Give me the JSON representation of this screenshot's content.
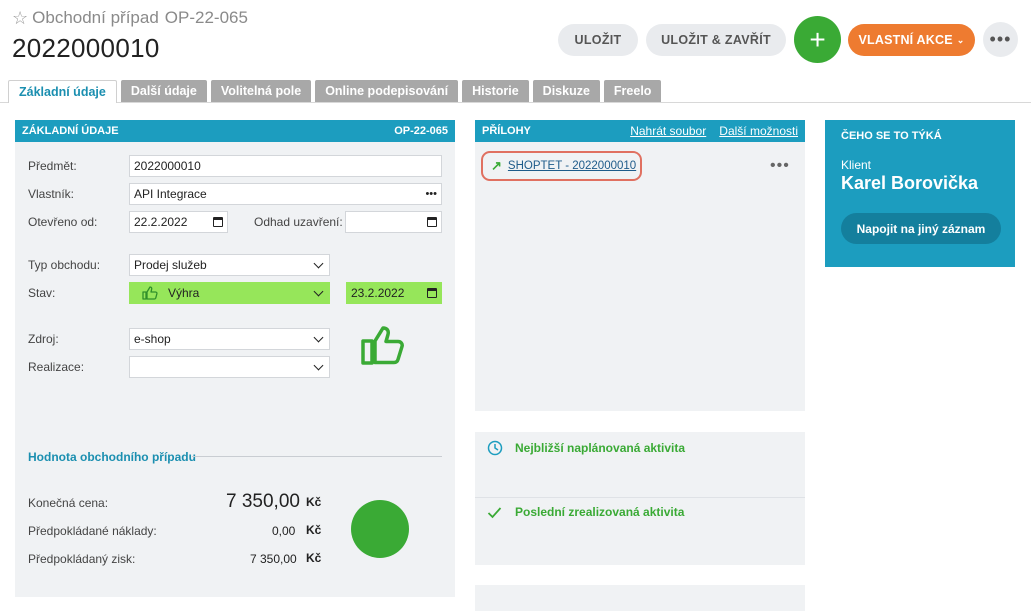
{
  "header": {
    "subtitle": "Obchodní případ",
    "code": "OP-22-065",
    "title": "2022000010",
    "buttons": {
      "save": "ULOŽIT",
      "save_close": "ULOŽIT & ZAVŘÍT",
      "plus": "+",
      "custom_action": "VLASTNÍ AKCE",
      "more": "•••"
    }
  },
  "tabs": [
    {
      "label": "Základní údaje",
      "active": true
    },
    {
      "label": "Další údaje"
    },
    {
      "label": "Volitelná pole"
    },
    {
      "label": "Online podepisování"
    },
    {
      "label": "Historie"
    },
    {
      "label": "Diskuze"
    },
    {
      "label": "Freelo"
    }
  ],
  "basic": {
    "title": "ZÁKLADNÍ ÚDAJE",
    "code": "OP-22-065",
    "subject_label": "Předmět:",
    "subject": "2022000010",
    "owner_label": "Vlastník:",
    "owner": "API Integrace",
    "owner_more": "•••",
    "opened_label": "Otevřeno od:",
    "opened": "22.2.2022",
    "close_label": "Odhad uzavření:",
    "close": "",
    "type_label": "Typ obchodu:",
    "type": "Prodej služeb",
    "state_label": "Stav:",
    "state": "Výhra",
    "state_date": "23.2.2022",
    "source_label": "Zdroj:",
    "source": "e-shop",
    "realization_label": "Realizace:",
    "realization": "",
    "value_title": "Hodnota obchodního případu",
    "final_price_label": "Konečná cena:",
    "final_price": "7 350,00",
    "costs_label": "Předpokládané náklady:",
    "costs": "0,00",
    "profit_label": "Předpokládaný zisk:",
    "profit": "7 350,00",
    "currency": "Kč"
  },
  "attachments": {
    "title": "PŘÍLOHY",
    "upload": "Nahrát soubor",
    "more_options": "Další možnosti",
    "file": "SHOPTET - 2022000010",
    "file_more": "•••"
  },
  "activities": {
    "next": "Nejbližší naplánovaná aktivita",
    "last": "Poslední zrealizovaná aktivita"
  },
  "side": {
    "title": "ČEHO SE TO TÝKÁ",
    "client_label": "Klient",
    "client_name": "Karel Borovička",
    "link_button": "Napojit na jiný záznam"
  },
  "colors": {
    "accent": "#1c9dbf",
    "success": "#3aaa35",
    "orange": "#ee7b30",
    "won_field": "#96e65a"
  }
}
